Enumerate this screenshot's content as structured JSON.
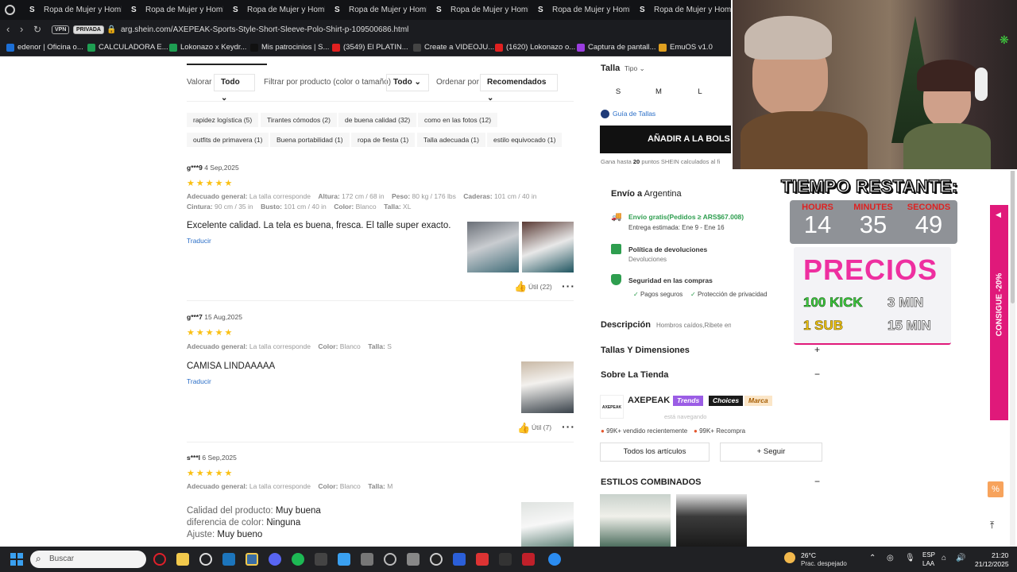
{
  "browser": {
    "tabs": [
      "Ropa de Mujer y Hombre",
      "Ropa de Mujer y Hombre",
      "Ropa de Mujer y Hombre",
      "Ropa de Mujer y Hombre",
      "Ropa de Mujer y Hombre",
      "Ropa de Mujer y Hombre",
      "Ropa de Mujer y Hombre"
    ],
    "tab_favicon": "S",
    "vpn_label": "VPN",
    "private_label": "PRIVADA",
    "url": "arg.shein.com/AXEPEAK-Sports-Style-Short-Sleeve-Polo-Shirt-p-109500686.html",
    "bookmarks": [
      "edenor | Oficina o...",
      "CALCULADORA E...",
      "Lokonazo x Keydr...",
      "Mis patrocinios | S...",
      "(3549) El PLATIN...",
      "Create a VIDEOJU...",
      "(1620) Lokonazo o...",
      "Captura de pantall...",
      "EmuOS v1.0"
    ]
  },
  "reviews": {
    "filter": {
      "rating_label": "Valorar",
      "rating_value": "Todo",
      "product_label": "Filtrar por producto (color o tamaño)",
      "product_value": "Todo",
      "sort_label": "Ordenar por",
      "sort_value": "Recomendados"
    },
    "tags": [
      "rapidez logística (5)",
      "Tirantes cómodos (2)",
      "de buena calidad (32)",
      "como en las fotos (12)",
      "outfits de primavera (1)",
      "Buena portabilidad (1)",
      "ropa de fiesta (1)",
      "Talla adecuada (1)",
      "estilo equivocado (1)"
    ],
    "items": [
      {
        "user": "g***9",
        "date": "4 Sep,2025",
        "meta1": [
          [
            "Adecuado general:",
            "La talla corresponde"
          ],
          [
            "Altura:",
            "172 cm / 68 in"
          ],
          [
            "Peso:",
            "80 kg / 176 lbs"
          ],
          [
            "Caderas:",
            "101 cm / 40 in"
          ]
        ],
        "meta2": [
          [
            "Cintura:",
            "90 cm / 35 in"
          ],
          [
            "Busto:",
            "101 cm / 40 in"
          ],
          [
            "Color:",
            "Blanco"
          ],
          [
            "Talla:",
            "XL"
          ]
        ],
        "text": "Excelente calidad. La tela es buena, fresca. El talle super exacto.",
        "translate": "Traducir",
        "useful": "Útil (22)"
      },
      {
        "user": "g***7",
        "date": "15 Aug,2025",
        "meta1": [
          [
            "Adecuado general:",
            "La talla corresponde"
          ],
          [
            "Color:",
            "Blanco"
          ],
          [
            "Talla:",
            "S"
          ]
        ],
        "text": "CAMISA LINDAAAAA",
        "translate": "Traducir",
        "useful": "Útil (7)"
      },
      {
        "user": "s***l",
        "date": "6 Sep,2025",
        "meta1": [
          [
            "Adecuado general:",
            "La talla corresponde"
          ],
          [
            "Color:",
            "Blanco"
          ],
          [
            "Talla:",
            "M"
          ]
        ],
        "lines": [
          [
            "Calidad del producto:",
            "Muy buena"
          ],
          [
            "diferencia de color:",
            "Ninguna"
          ],
          [
            "Ajuste:",
            "Muy bueno"
          ]
        ]
      }
    ],
    "stars": "★★★★★"
  },
  "product": {
    "size_label": "Talla",
    "size_type": "Tipo",
    "sizes": [
      "S",
      "M",
      "L"
    ],
    "size_guide": "Guía de Tallas",
    "add_to_bag": "AÑADIR A LA BOLS",
    "points_prefix": "Gana hasta",
    "points_value": "20",
    "points_suffix": "puntos SHEIN calculados al fi",
    "ship_to_label": "Envío a",
    "ship_to_value": "Argentina",
    "free_shipping": "Envío gratis(Pedidos ≥ ARS$67.008)",
    "estimated": "Entrega estimada: Ene 9 - Ene 16",
    "returns_title": "Política de devoluciones",
    "returns_sub": "Devoluciones",
    "security_title": "Seguridad en las compras",
    "security_items": [
      "Pagos seguros",
      "Protección de privacidad"
    ],
    "description_label": "Descripción",
    "description_text": "Hombros caídos,Ribete en contraste,Lavadora, no la",
    "sizes_section": "Tallas Y Dimensiones",
    "sizes_section_icon": "+",
    "store_section": "Sobre La Tienda",
    "store_section_icon": "−",
    "store_name": "AXEPEAK",
    "store_logo_text": "AXEPEAK",
    "store_badges": [
      "Trends",
      "Choices",
      "Marca"
    ],
    "store_browsing": "está navegando",
    "sold_recent": "99K+ vendido recientemente",
    "repurchase": "99K+ Recompra",
    "all_items": "Todos los artículos",
    "follow": "+ Seguir",
    "combined_styles": "ESTILOS COMBINADOS",
    "combined_icon": "−"
  },
  "overlay": {
    "timer_title": "TIEMPO RESTANTE:",
    "hours_label": "HOURS",
    "hours": "14",
    "minutes_label": "MINUTES",
    "minutes": "35",
    "seconds_label": "SECONDS",
    "seconds": "49",
    "prices_title": "PRECIOS",
    "kick_label": "100 KICK",
    "kick_value": "3 MIN",
    "sub_label": "1 SUB",
    "sub_value": "15 MIN",
    "side_banner": "CONSIGUE -20%"
  },
  "taskbar": {
    "search_placeholder": "Buscar",
    "weather_temp": "26°C",
    "weather_desc": "Prac. despejado",
    "lang_top": "ESP",
    "lang_bottom": "LAA",
    "time": "21:20",
    "date": "21/12/2025"
  },
  "colors": {
    "accent": "#e0197a",
    "star": "#fac014",
    "link": "#2a6ec7",
    "green": "#2e9e4f",
    "timer_red": "#d22"
  }
}
